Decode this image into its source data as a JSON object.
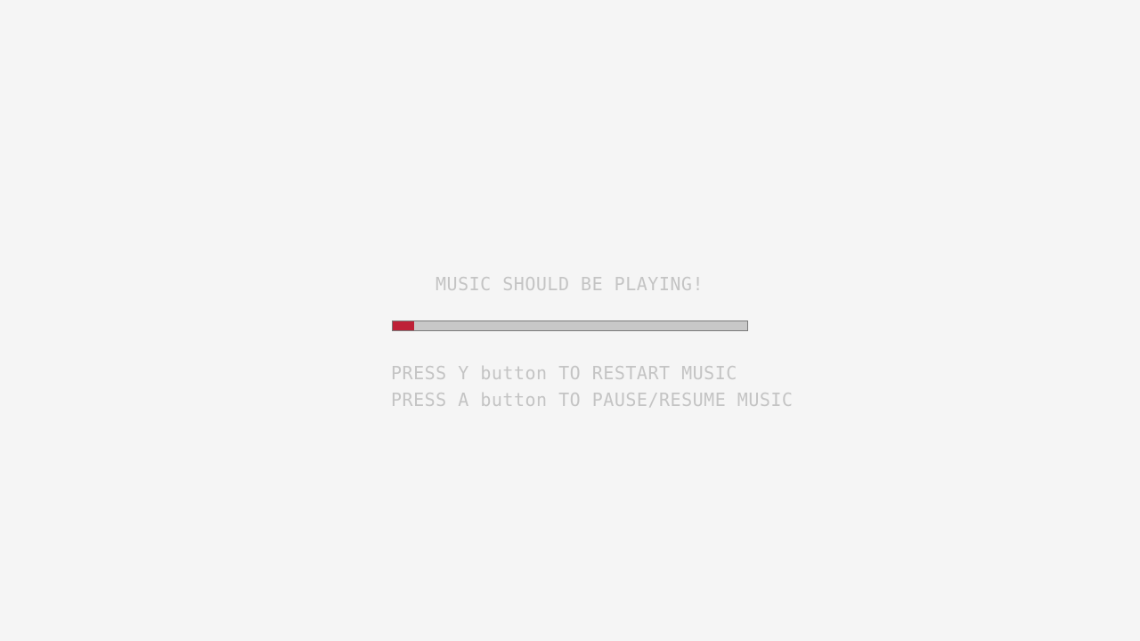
{
  "status_text": "MUSIC SHOULD BE PLAYING!",
  "progress": {
    "fraction": 0.06,
    "fill_color": "#be2137",
    "track_color": "#c8c8c8"
  },
  "hints": [
    "PRESS Y button TO RESTART MUSIC",
    "PRESS A button TO PAUSE/RESUME MUSIC"
  ],
  "colors": {
    "background": "#f5f5f5",
    "text": "#c4c4c4"
  }
}
